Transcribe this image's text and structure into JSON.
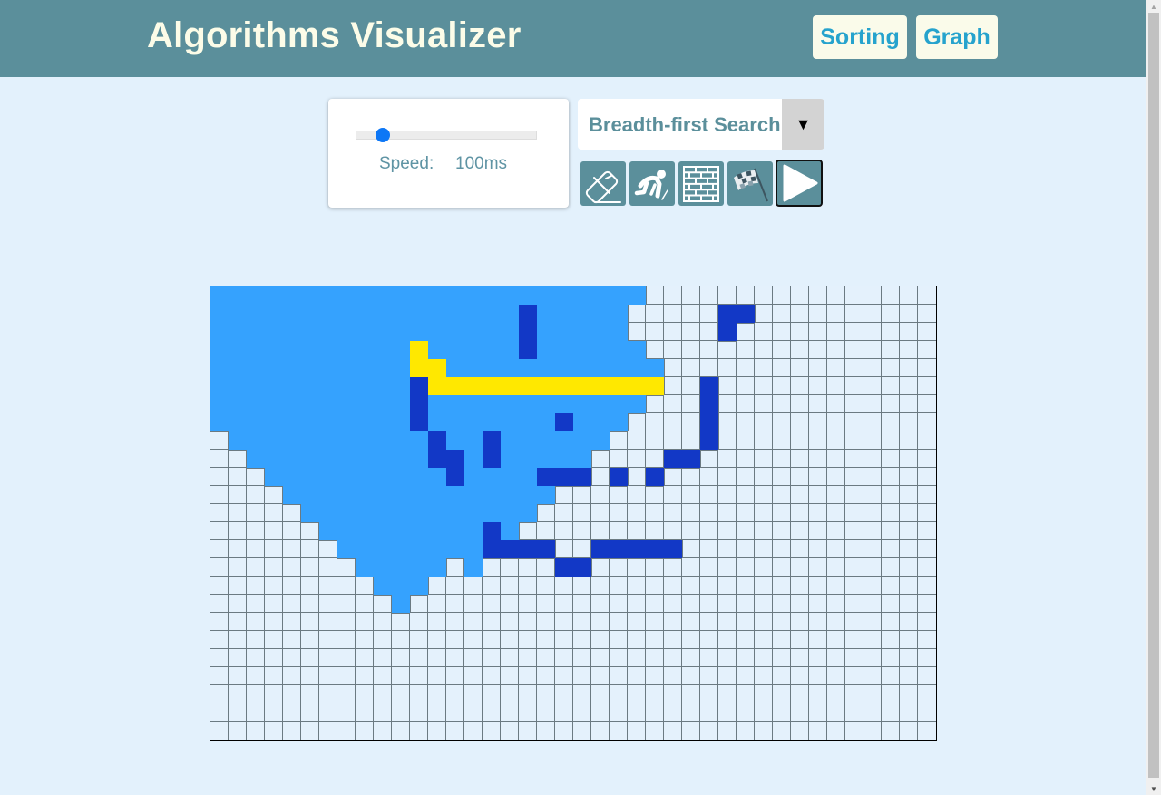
{
  "header": {
    "title": "Algorithms Visualizer",
    "nav": [
      {
        "label": "Sorting"
      },
      {
        "label": "Graph"
      }
    ]
  },
  "speed": {
    "label": "Speed:",
    "value": "100ms",
    "slider_fraction": 0.13
  },
  "algorithm": {
    "selected": "Breadth-first Search",
    "arrow": "▼"
  },
  "tools": [
    {
      "name": "eraser-icon",
      "title": "Erase"
    },
    {
      "name": "runner-start-icon",
      "title": "Start"
    },
    {
      "name": "brick-wall-icon",
      "title": "Wall"
    },
    {
      "name": "checkered-flag-icon",
      "title": "Finish"
    },
    {
      "name": "play-icon",
      "title": "Run"
    }
  ],
  "colors": {
    "header_bg": "#5b8f9b",
    "page_bg": "#e3f1fc",
    "visited": "#35a2fe",
    "wall": "#1238c6",
    "path": "#ffe800",
    "unvisited": "#e4f1fc",
    "nav_text": "#26a3cd",
    "title_text": "#fcfce8"
  },
  "grid": {
    "rows": 25,
    "cols": 40,
    "legend": {
      ".": "unvisited",
      "v": "visited",
      "W": "wall",
      "P": "path"
    },
    "cells": [
      "vvvvvvvvvvvvvvvvvvvvvvvv................",
      "vvvvvvvvvvvvvvvvvWvvvvv.....WW..........",
      "vvvvvvvvvvvvvvvvvWvvvvv.....W...........",
      "vvvvvvvvvvvPvvvvvWvvvvvv................",
      "vvvvvvvvvvvPPvvvvvvvvvvvv...............",
      "vvvvvvvvvvvWPPPPPPPPPPPPP..W............",
      "vvvvvvvvvvvWvvvvvvvvvvvv...W............",
      "vvvvvvvvvvvWvvvvvvvWvvv....W............",
      ".vvvvvvvvvvvWvvWvvvvvv.....W............",
      "..vvvvvvvvvvWWvWvvvvv....WW.............",
      "...vvvvvvvvvvWvvvvWWW.W.W...............",
      "....vvvvvvvvvvvvvvv.....................",
      ".....vvvvvvvvvvvvv......................",
      "......vvvvvvvvvWv.......................",
      ".......vvvvvvvvWWWW..WWWWW..............",
      "........vvvvv.v....WW...................",
      ".........vvv............................",
      "..........v.............................",
      "........................................",
      "........................................",
      "........................................",
      "........................................",
      "........................................",
      "........................................",
      "........................................"
    ]
  }
}
